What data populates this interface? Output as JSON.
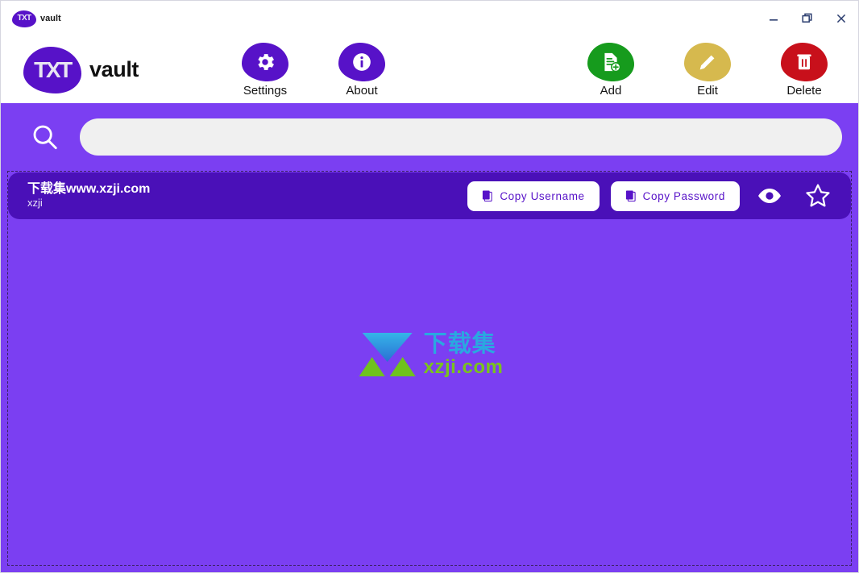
{
  "window": {
    "titlebar_title": "vault",
    "logo_mark": "TXT",
    "controls": [
      {
        "name": "minimize",
        "glyph": "minimize-icon"
      },
      {
        "name": "restore",
        "glyph": "restore-icon"
      },
      {
        "name": "close",
        "glyph": "close-icon"
      }
    ]
  },
  "header": {
    "brand_mark": "TXT",
    "brand_name": "vault",
    "left_tools": [
      {
        "label": "Settings",
        "icon": "gear-icon",
        "color": "#5712c8"
      },
      {
        "label": "About",
        "icon": "info-icon",
        "color": "#5712c8"
      }
    ],
    "right_tools": [
      {
        "label": "Add",
        "icon": "document-plus-icon",
        "color": "#169b1d"
      },
      {
        "label": "Edit",
        "icon": "pencil-icon",
        "color": "#d6b94e"
      },
      {
        "label": "Delete",
        "icon": "trash-icon",
        "color": "#c8101b"
      }
    ]
  },
  "search": {
    "icon": "search-icon",
    "value": "",
    "placeholder": ""
  },
  "list": {
    "entries": [
      {
        "title": "下载集www.xzji.com",
        "subtitle": "xzji",
        "copy_username_label": "Copy  Username",
        "copy_password_label": "Copy  Password",
        "reveal_icon": "eye-icon",
        "favorite_icon": "star-outline-icon"
      }
    ]
  },
  "watermark": {
    "cn_text": "下载集",
    "en_text": "xzji.com"
  },
  "colors": {
    "body_purple": "#7b3ff2",
    "row_purple": "#4a10b8",
    "brand_purple": "#5712c8",
    "add_green": "#169b1d",
    "edit_gold": "#d6b94e",
    "delete_red": "#c8101b",
    "search_field": "#f0f0f0"
  }
}
